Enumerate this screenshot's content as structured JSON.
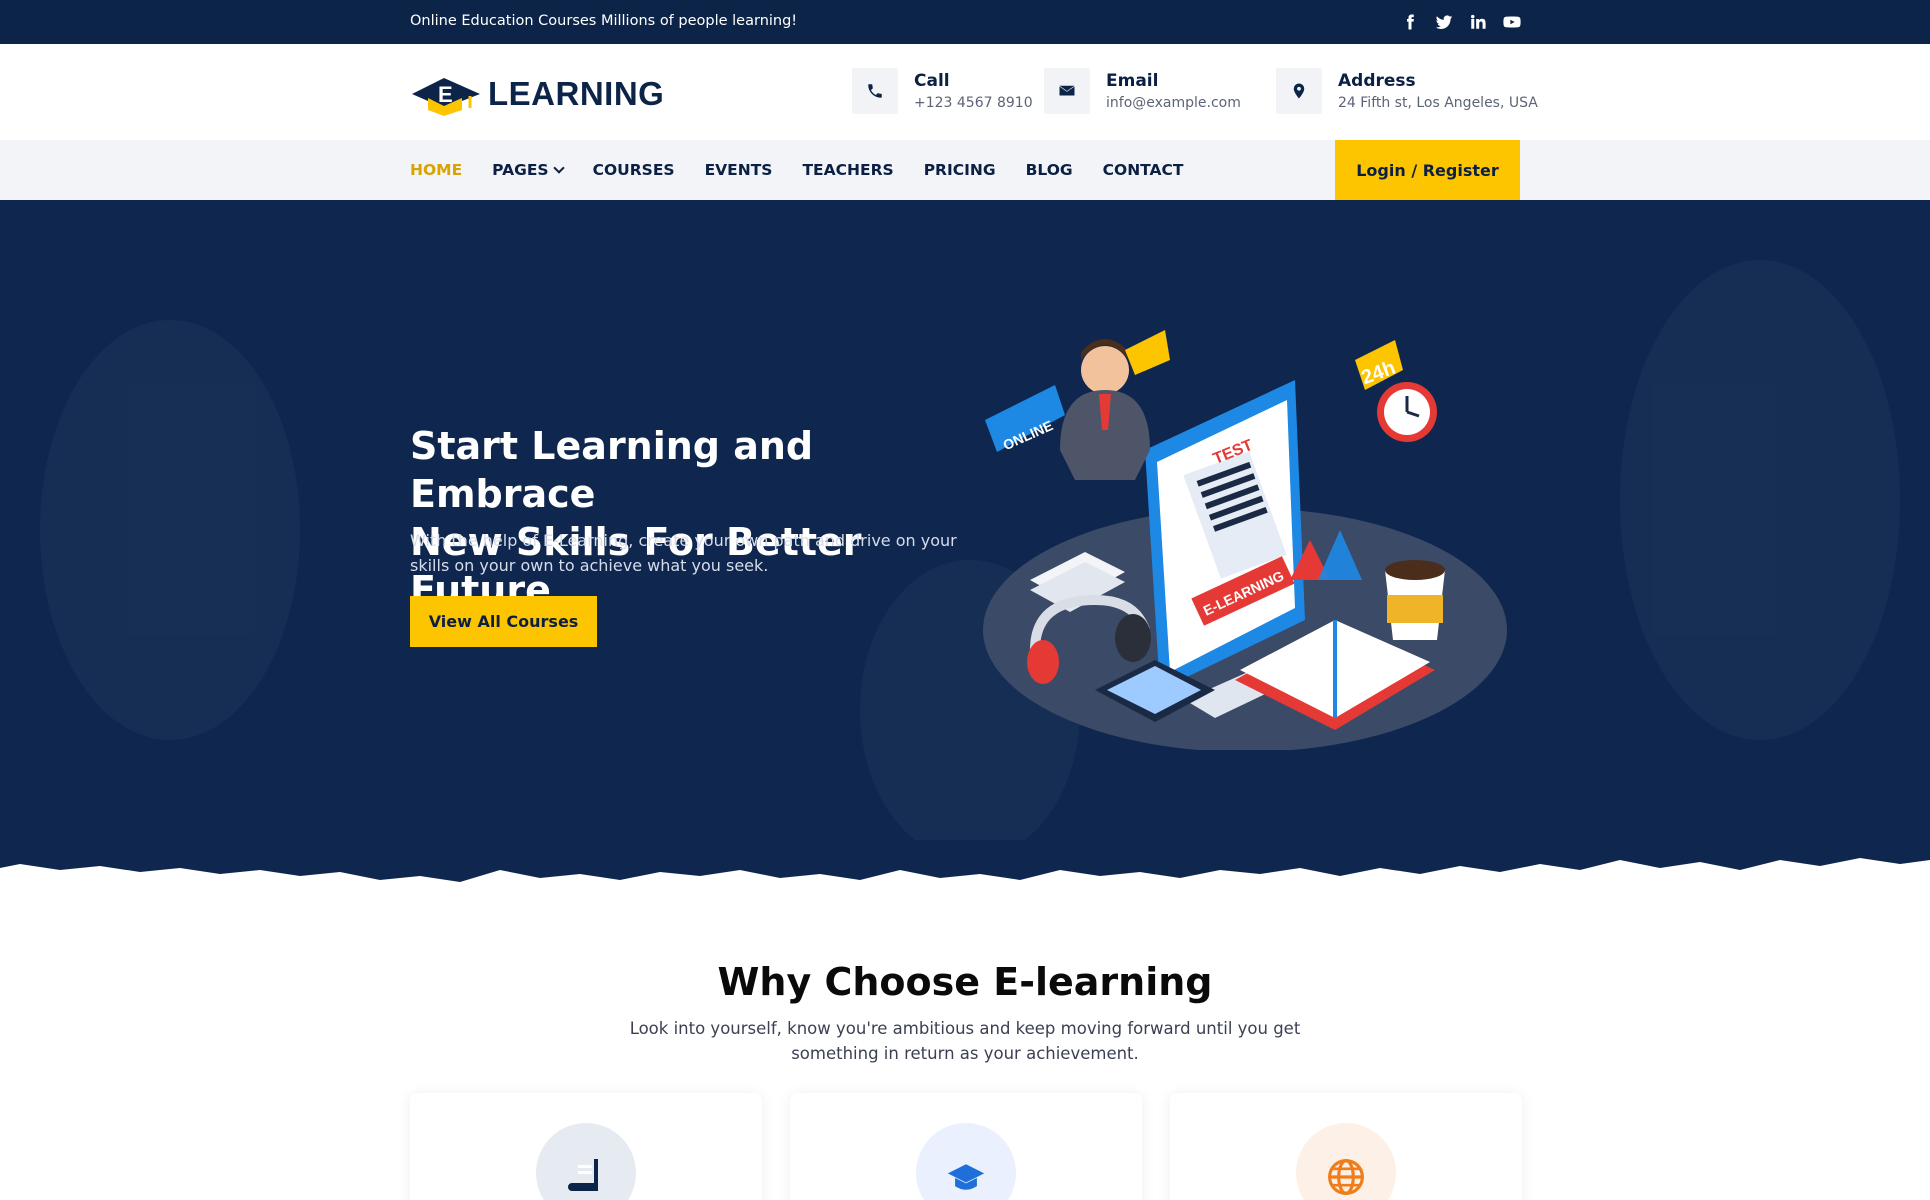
{
  "topbar": {
    "message": "Online Education Courses Millions of people learning!",
    "social": [
      "facebook-icon",
      "twitter-icon",
      "linkedin-icon",
      "youtube-icon"
    ]
  },
  "header": {
    "logo_letter": "E",
    "logo_text": "LEARNING",
    "contacts": [
      {
        "title": "Call",
        "value": "+123 4567 8910",
        "icon": "phone-icon"
      },
      {
        "title": "Email",
        "value": "info@example.com",
        "icon": "envelope-icon"
      },
      {
        "title": "Address",
        "value": "24 Fifth st, Los Angeles, USA",
        "icon": "map-pin-icon"
      }
    ]
  },
  "nav": {
    "items": [
      "HOME",
      "PAGES",
      "COURSES",
      "EVENTS",
      "TEACHERS",
      "PRICING",
      "BLOG",
      "CONTACT"
    ],
    "active": "HOME",
    "login_label": "Login / Register"
  },
  "hero": {
    "title_line1": "Start Learning and Embrace",
    "title_line2": "New Skills For Better Future",
    "description": "With the help of E-Learning, create your own path and drive on your skills on your own to achieve what you seek.",
    "button_label": "View All Courses",
    "illustration_labels": [
      "ONLINE",
      "TEST",
      "24h",
      "E-LEARNING"
    ]
  },
  "why": {
    "title": "Why Choose E-learning",
    "description": "Look into yourself, know you're ambitious and keep moving forward until you get something in return as your achievement.",
    "cards": [
      {
        "icon": "book-icon",
        "color": "#e8ecf3"
      },
      {
        "icon": "graduation-cap-icon",
        "color": "#eaf0fd"
      },
      {
        "icon": "globe-icon",
        "color": "#fdf0e6"
      }
    ]
  },
  "colors": {
    "primary": "#0c2448",
    "accent": "#fdc400",
    "active_nav": "#d9a400"
  }
}
